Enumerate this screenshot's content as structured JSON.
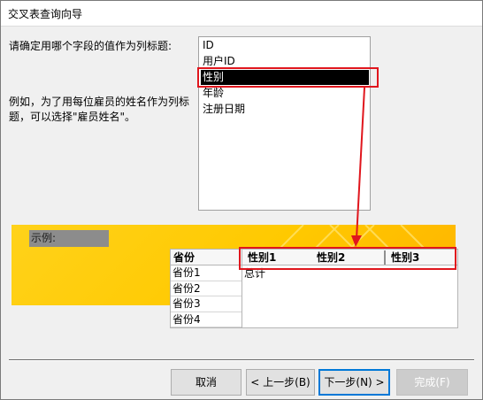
{
  "window": {
    "title": "交叉表查询向导"
  },
  "prompt": "请确定用哪个字段的值作为列标题:",
  "hint": "例如，为了用每位雇员的姓名作为列标题，可以选择\"雇员姓名\"。",
  "fields": [
    "ID",
    "用户ID",
    "性别",
    "年龄",
    "注册日期"
  ],
  "selected_field": "性别",
  "sample": {
    "label": "示例:",
    "row_header": "省份",
    "rows": [
      "省份1",
      "省份2",
      "省份3",
      "省份4"
    ],
    "columns": [
      "性别1",
      "性别2",
      "性别3"
    ],
    "total_label": "总计"
  },
  "buttons": {
    "cancel": "取消",
    "back": "< 上一步(B)",
    "next": "下一步(N) >",
    "finish": "完成(F)"
  },
  "colors": {
    "highlight": "#e0161d",
    "sample_bg": "#ffc900",
    "primary_border": "#0078d7"
  }
}
